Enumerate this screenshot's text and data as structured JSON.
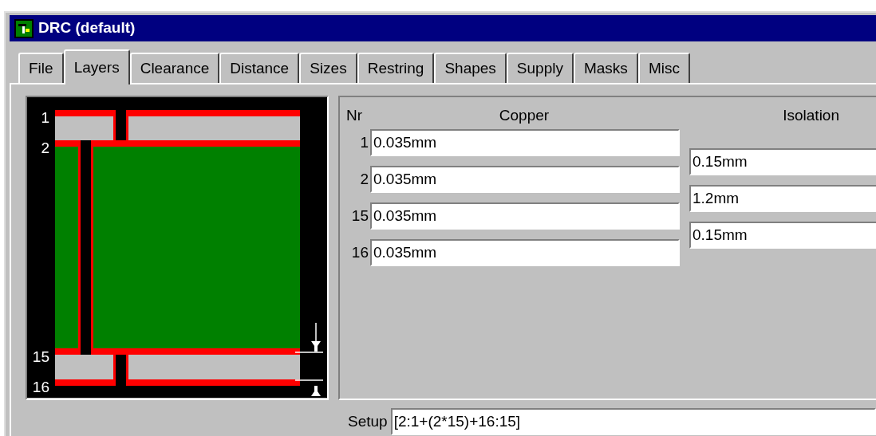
{
  "window": {
    "title": "DRC (default)"
  },
  "tabs": [
    {
      "label": "File",
      "selected": false
    },
    {
      "label": "Layers",
      "selected": true
    },
    {
      "label": "Clearance",
      "selected": false
    },
    {
      "label": "Distance",
      "selected": false
    },
    {
      "label": "Sizes",
      "selected": false
    },
    {
      "label": "Restring",
      "selected": false
    },
    {
      "label": "Shapes",
      "selected": false
    },
    {
      "label": "Supply",
      "selected": false
    },
    {
      "label": "Masks",
      "selected": false
    },
    {
      "label": "Misc",
      "selected": false
    }
  ],
  "diagram": {
    "layer_numbers": [
      "1",
      "2",
      "15",
      "16"
    ]
  },
  "layers": {
    "columns": [
      "Nr",
      "Copper",
      "Isolation"
    ],
    "copper": [
      {
        "nr": "1",
        "value": "0.035mm"
      },
      {
        "nr": "2",
        "value": "0.035mm"
      },
      {
        "nr": "15",
        "value": "0.035mm"
      },
      {
        "nr": "16",
        "value": "0.035mm"
      }
    ],
    "isolation": [
      "0.15mm",
      "1.2mm",
      "0.15mm"
    ]
  },
  "setup": {
    "label": "Setup",
    "value": "[2:1+(2*15)+16:15]"
  }
}
